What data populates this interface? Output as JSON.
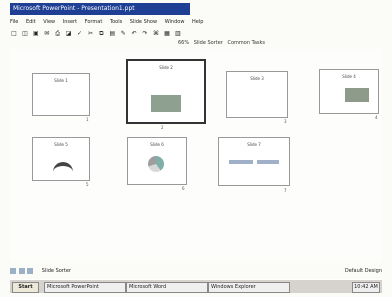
{
  "window": {
    "title": "Microsoft PowerPoint - Presentation1.ppt"
  },
  "menu": [
    "File",
    "Edit",
    "View",
    "Insert",
    "Format",
    "Tools",
    "Slide Show",
    "Window",
    "Help"
  ],
  "toolbar": {
    "icons": [
      "new-icon",
      "open-icon",
      "save-icon",
      "email-icon",
      "print-icon",
      "preview-icon",
      "spell-icon",
      "cut-icon",
      "copy-icon",
      "paste-icon",
      "format-painter-icon",
      "undo-icon",
      "redo-icon",
      "hyperlink-icon",
      "tables-icon",
      "chart-icon"
    ]
  },
  "toolbar2": {
    "zoom": "66%",
    "labels": [
      "Slide Sorter",
      "Common Tasks"
    ]
  },
  "slides": [
    {
      "num": "1",
      "title": "Slide 1"
    },
    {
      "num": "2",
      "title": "Slide 2"
    },
    {
      "num": "3",
      "title": "Slide 3"
    },
    {
      "num": "4",
      "title": "Slide 4"
    },
    {
      "num": "5",
      "title": "Slide 5"
    },
    {
      "num": "6",
      "title": "Slide 6"
    },
    {
      "num": "7",
      "title": "Slide 7"
    }
  ],
  "status": {
    "left": "Slide Sorter",
    "right": "Default Design"
  },
  "taskbar": {
    "start": "Start",
    "buttons": [
      "Microsoft PowerPoint",
      "Microsoft Word",
      "Windows Explorer"
    ],
    "clock": "10:42 AM"
  }
}
